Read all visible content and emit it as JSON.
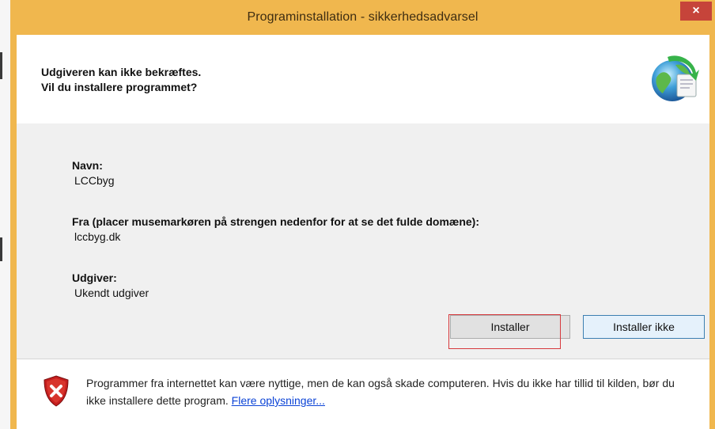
{
  "window": {
    "title": "Programinstallation - sikkerhedsadvarsel",
    "close_glyph": "×"
  },
  "header": {
    "line1": "Udgiveren kan ikke bekræftes.",
    "line2": "Vil du installere programmet?",
    "icon": "globe-install-icon"
  },
  "details": {
    "name_label": "Navn:",
    "name_value": "LCCbyg",
    "from_label": "Fra (placer musemarkøren på strengen nedenfor for at se det fulde domæne):",
    "from_value": "lccbyg.dk",
    "publisher_label": "Udgiver:",
    "publisher_value": "Ukendt udgiver"
  },
  "buttons": {
    "install": "Installer",
    "dont_install": "Installer ikke"
  },
  "footer": {
    "icon": "shield-warning-icon",
    "warning": "Programmer fra internettet kan være nyttige, men de kan også skade computeren. Hvis du ikke har tillid til kilden, bør du ikke installere dette program.",
    "link": "Flere oplysninger..."
  },
  "colors": {
    "titlebar": "#f0b74e",
    "close": "#c6443a",
    "link": "#0b43d6",
    "focus_highlight": "#d7393d"
  }
}
